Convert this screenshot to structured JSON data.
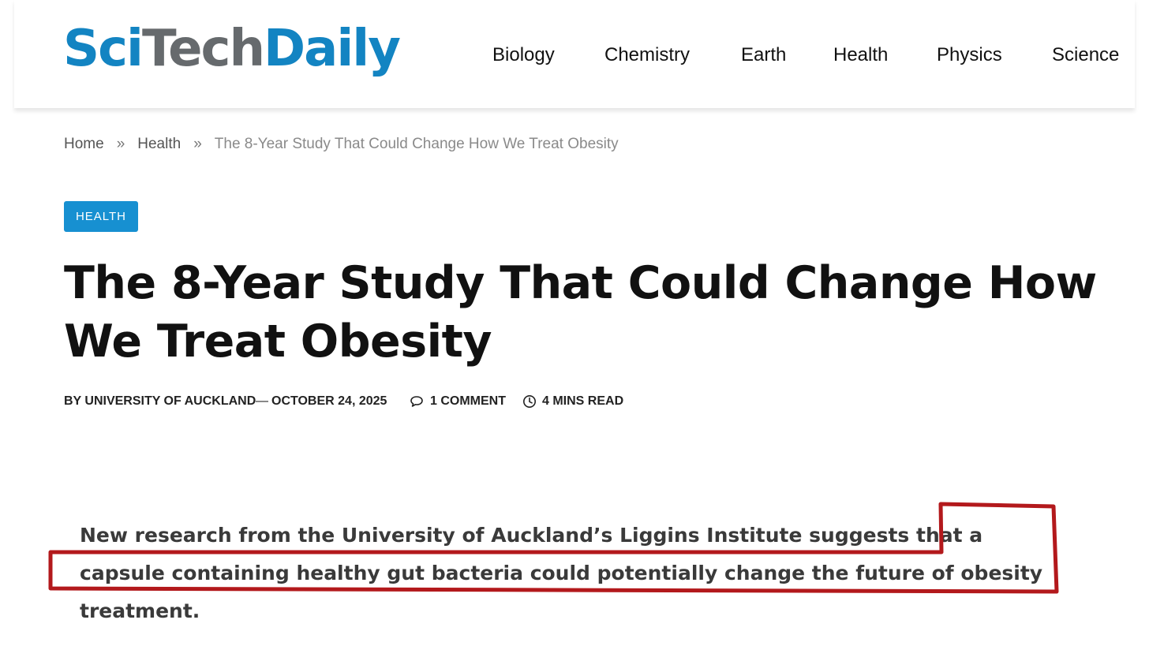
{
  "site": {
    "logo_sci": "Sci",
    "logo_tech": "Tech",
    "logo_daily": "Daily"
  },
  "nav": {
    "items": [
      {
        "label": "Biology"
      },
      {
        "label": "Chemistry"
      },
      {
        "label": "Earth"
      },
      {
        "label": "Health"
      },
      {
        "label": "Physics"
      },
      {
        "label": "Science"
      }
    ]
  },
  "breadcrumb": {
    "home": "Home",
    "separator": "»",
    "section": "Health",
    "current": "The 8-Year Study That Could Change How We Treat Obesity"
  },
  "article": {
    "category": "HEALTH",
    "title": "The 8-Year Study That Could Change How We Treat Obesity",
    "meta": {
      "author": "BY UNIVERSITY OF AUCKLAND",
      "dash": "—",
      "date": "OCTOBER 24, 2025",
      "comments": "1 COMMENT",
      "read_time": "4 MINS READ"
    },
    "lead": "New research from the University of Auckland’s Liggins Institute suggests that a capsule containing healthy gut bacteria could potentially change the future of obesity treatment."
  },
  "colors": {
    "brand_blue": "#1384c2",
    "brand_gray": "#666a6d",
    "badge_blue": "#1790d1",
    "highlight_red": "#b3191c"
  },
  "icons": [
    "comment-icon",
    "clock-icon"
  ]
}
